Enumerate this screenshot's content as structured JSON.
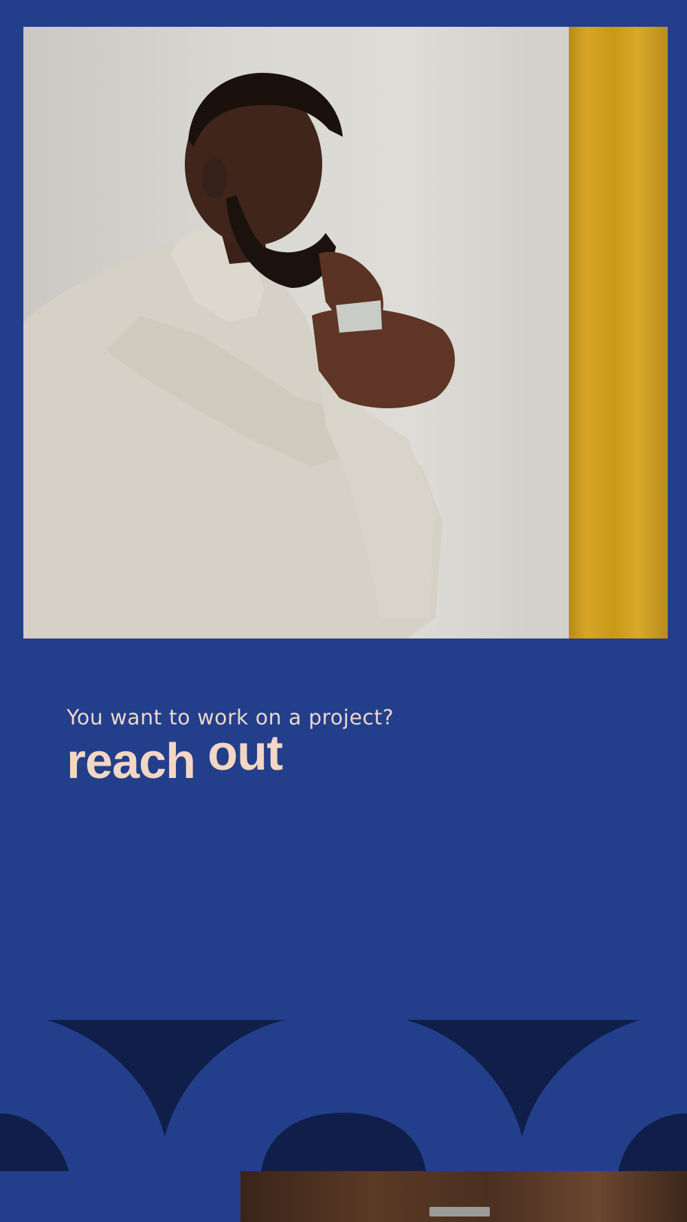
{
  "colors": {
    "background": "#233f8b",
    "dark_navy": "#101e4a",
    "text_peach": "#f3d6c3",
    "curtain_mustard": "#d3a023"
  },
  "hero": {
    "image_description_icon": "photo-person-on-phone"
  },
  "intro": {
    "question": "You want to work on a project?",
    "cta_word_1": "reach",
    "cta_word_2": "out"
  }
}
